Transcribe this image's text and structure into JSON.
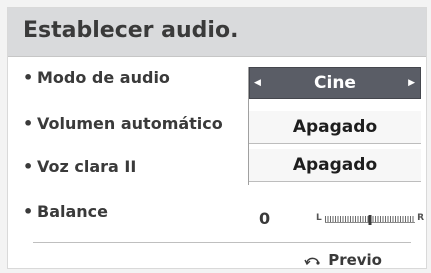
{
  "title": "Establecer audio.",
  "rows": [
    {
      "label": "Modo de audio",
      "value": "Cine"
    },
    {
      "label": "Volumen automático",
      "value": "Apagado"
    },
    {
      "label": "Voz clara II",
      "value": "Apagado"
    },
    {
      "label": "Balance",
      "value": "0"
    }
  ],
  "balance": {
    "left_label": "L",
    "right_label": "R",
    "position_fraction": 0.5
  },
  "footer": {
    "back_label": "Previo"
  },
  "colors": {
    "title_bar": "#d9dadc",
    "selected_bg": "#5a5d66",
    "text": "#3a3a3a"
  },
  "icons": {
    "back": "return-arrow-icon",
    "left": "left-arrow-icon",
    "right": "right-arrow-icon"
  }
}
